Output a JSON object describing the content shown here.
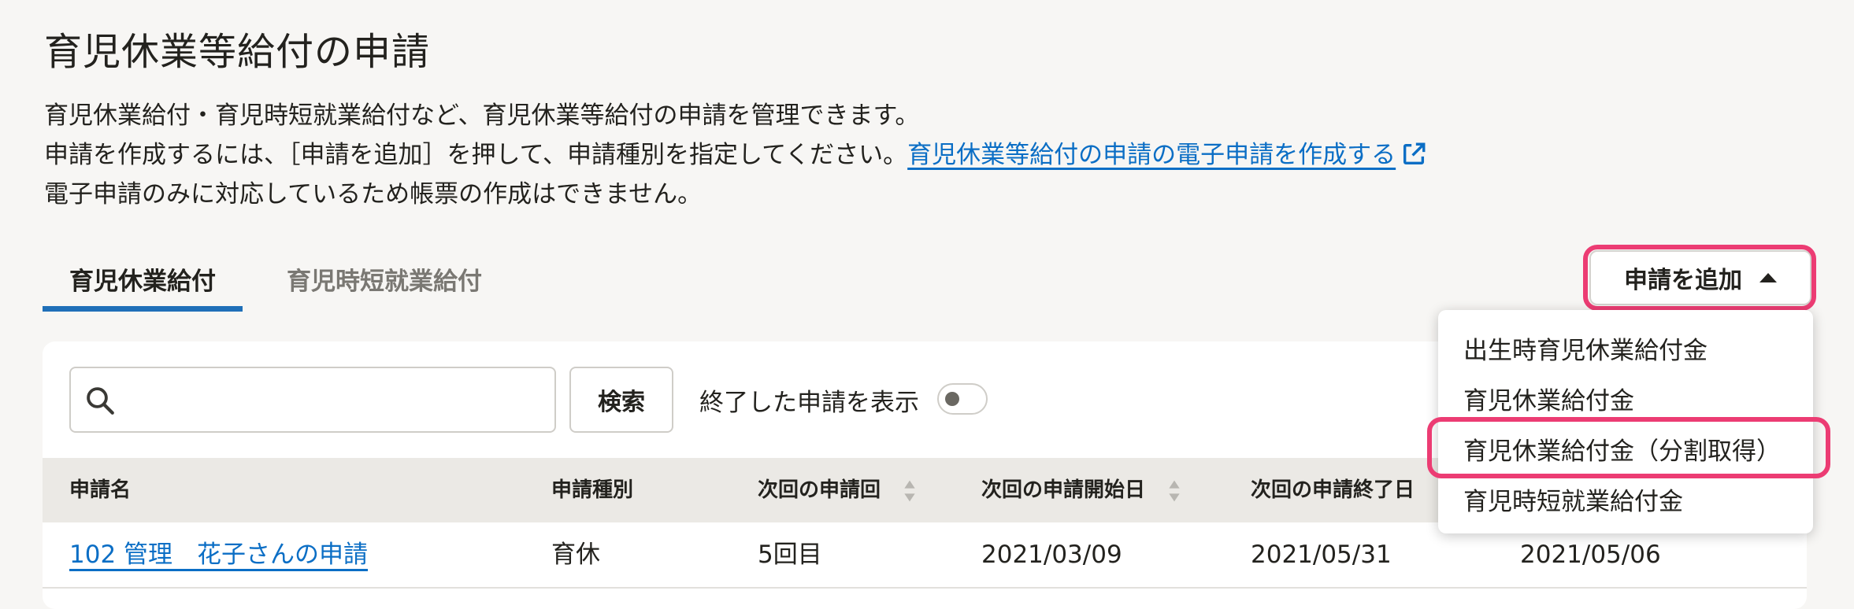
{
  "page": {
    "title": "育児休業等給付の申請",
    "description_line1": "育児休業給付・育児時短就業給付など、育児休業等給付の申請を管理できます。",
    "description_line2_text": "申請を作成するには、［申請を追加］を押して、申請種別を指定してください。",
    "description_line2_link": "育児休業等給付の申請の電子申請を作成する",
    "description_line3": "電子申請のみに対応しているため帳票の作成はできません。"
  },
  "tabs": [
    {
      "label": "育児休業給付",
      "active": true
    },
    {
      "label": "育児時短就業給付",
      "active": false
    }
  ],
  "add_button": {
    "label": "申請を追加",
    "menu": [
      "出生時育児休業給付金",
      "育児休業給付金",
      "育児休業給付金（分割取得）",
      "育児時短就業給付金"
    ],
    "highlighted_item": "育児休業給付金（分割取得）"
  },
  "search": {
    "placeholder": "",
    "button_label": "検索",
    "toggle_label": "終了した申請を表示",
    "toggle_on": false
  },
  "table": {
    "columns": [
      "申請名",
      "申請種別",
      "次回の申請回",
      "次回の申請開始日",
      "次回の申請終了日"
    ],
    "rows": [
      {
        "name": "102 管理　花子さんの申請",
        "type": "育休",
        "next_round": "5回目",
        "next_start": "2021/03/09",
        "next_end": "2021/05/31",
        "extra": "2021/05/06"
      }
    ]
  },
  "colors": {
    "link": "#0b6ec5",
    "tab_underline": "#1f6fb8",
    "highlight": "#ec3c73",
    "background": "#f7f6f4"
  },
  "icons": [
    "external-link-icon",
    "search-icon",
    "caret-up-icon",
    "sort-icon"
  ]
}
